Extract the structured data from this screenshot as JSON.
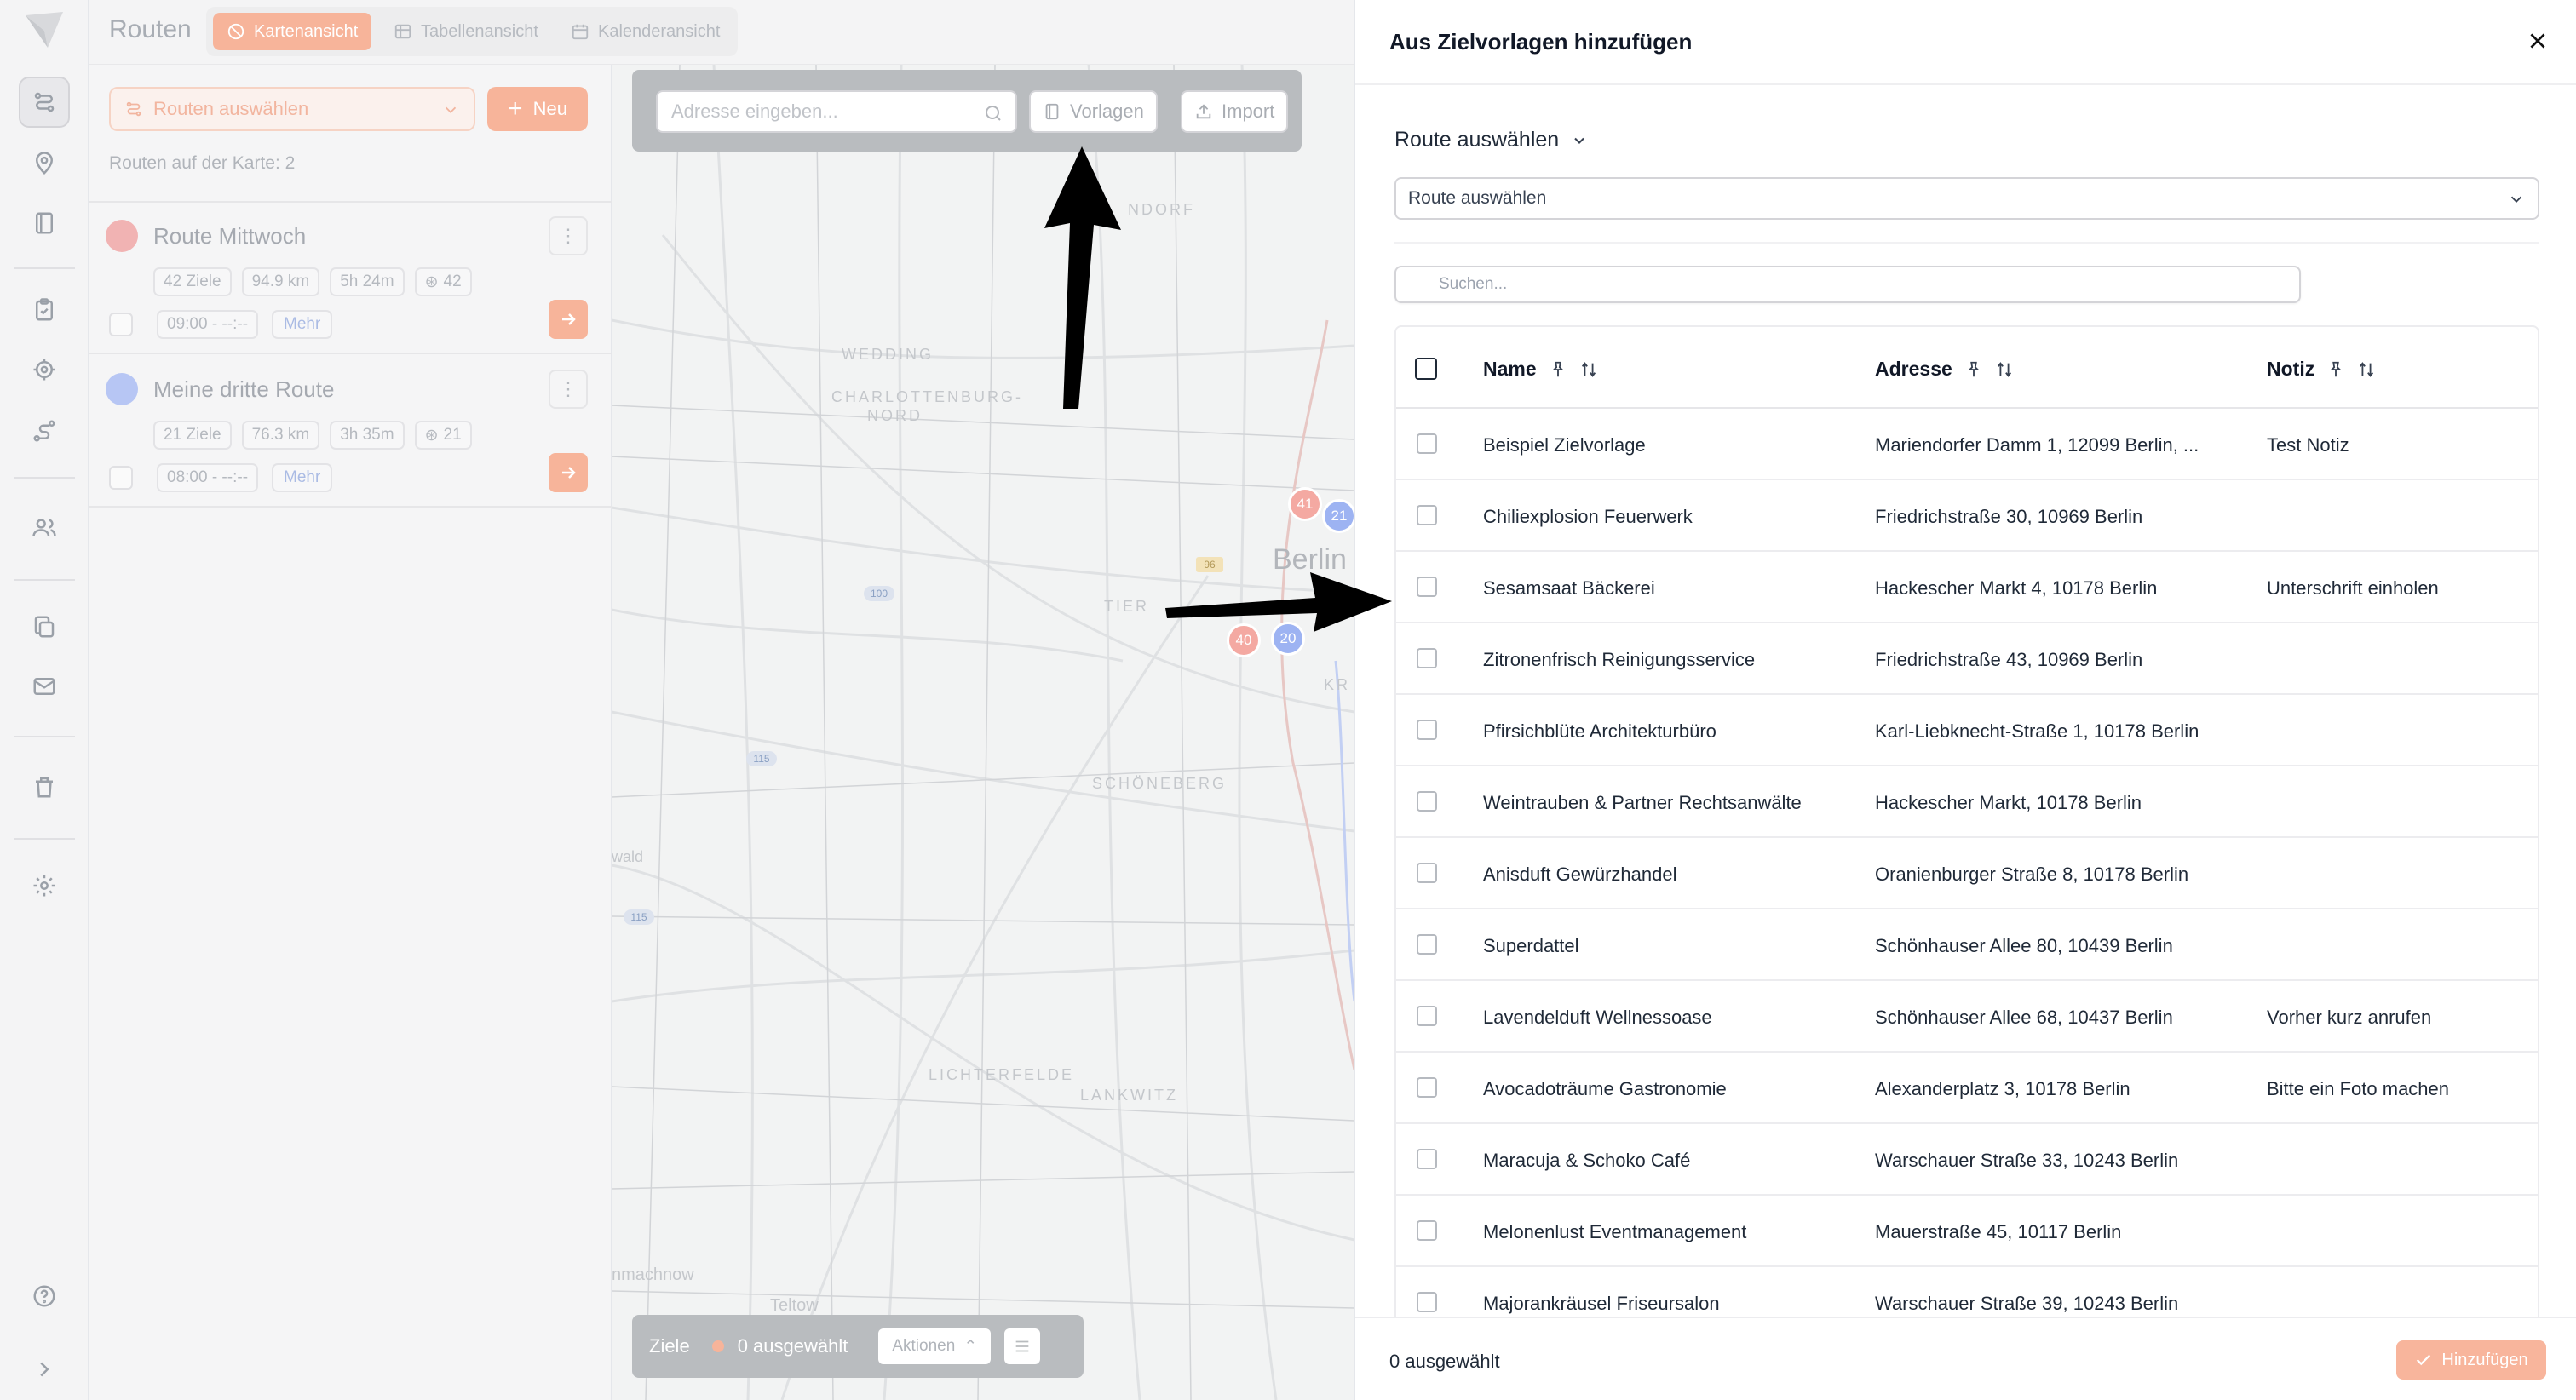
{
  "app": {
    "title": "Routen"
  },
  "view_tabs": [
    {
      "label": "Kartenansicht",
      "active": true,
      "icon": "map-icon"
    },
    {
      "label": "Tabellenansicht",
      "active": false,
      "icon": "table-icon"
    },
    {
      "label": "Kalenderansicht",
      "active": false,
      "icon": "calendar-icon"
    }
  ],
  "routes_panel": {
    "select_label": "Routen auswählen",
    "new_label": "Neu",
    "count_text": "Routen auf der Karte: 2",
    "routes": [
      {
        "name": "Route Mittwoch",
        "color": "#f1b3b3",
        "stops": "42 Ziele",
        "distance": "94.9 km",
        "duration": "5h 24m",
        "packages": "42",
        "time": "09:00 - --:--",
        "more": "Mehr"
      },
      {
        "name": "Meine dritte Route",
        "color": "#b7c6f4",
        "stops": "21 Ziele",
        "distance": "76.3 km",
        "duration": "3h 35m",
        "packages": "21",
        "time": "08:00 - --:--",
        "more": "Mehr"
      }
    ]
  },
  "map": {
    "address_placeholder": "Adresse eingeben...",
    "templates_label": "Vorlagen",
    "import_label": "Import",
    "labels": {
      "dorf": "NDORF",
      "wedding": "WEDDING",
      "charlottenburg": "CHARLOTTENBURG-",
      "nord": "NORD",
      "tier": "TIER",
      "berlin": "Berlin",
      "kr": "KR",
      "schoeneberg": "SCHÖNEBERG",
      "lichterfelde": "LICHTERFELDE",
      "lankwitz": "LANKWITZ",
      "wald": "wald",
      "machnow": "nmachnow",
      "teltow": "Teltow"
    },
    "road_badges": {
      "b96": "96",
      "b100": "100",
      "b115a": "115",
      "b115b": "115"
    },
    "markers": [
      {
        "label": "41",
        "color": "#f4a9a2"
      },
      {
        "label": "21",
        "color": "#9db3f2"
      },
      {
        "label": "40",
        "color": "#f4a9a2"
      },
      {
        "label": "20",
        "color": "#9db3f2"
      }
    ],
    "bottom_bar": {
      "label": "Ziele",
      "selected": "0 ausgewählt",
      "actions": "Aktionen"
    }
  },
  "dialog": {
    "title": "Aus Zielvorlagen hinzufügen",
    "route_section_label": "Route auswählen",
    "route_select_value": "Route auswählen",
    "search_placeholder": "Suchen...",
    "columns": {
      "name": "Name",
      "address": "Adresse",
      "note": "Notiz"
    },
    "rows": [
      {
        "name": "Beispiel Zielvorlage",
        "address": "Mariendorfer Damm 1, 12099 Berlin, ...",
        "note": "Test Notiz"
      },
      {
        "name": "Chiliexplosion Feuerwerk",
        "address": "Friedrichstraße 30, 10969 Berlin",
        "note": ""
      },
      {
        "name": "Sesamsaat Bäckerei",
        "address": "Hackescher Markt 4, 10178 Berlin",
        "note": "Unterschrift einholen"
      },
      {
        "name": "Zitronenfrisch Reinigungsservice",
        "address": "Friedrichstraße 43, 10969 Berlin",
        "note": ""
      },
      {
        "name": "Pfirsichblüte Architekturbüro",
        "address": "Karl-Liebknecht-Straße 1, 10178 Berlin",
        "note": ""
      },
      {
        "name": "Weintrauben & Partner Rechtsanwälte",
        "address": "Hackescher Markt, 10178 Berlin",
        "note": ""
      },
      {
        "name": "Anisduft Gewürzhandel",
        "address": "Oranienburger Straße 8, 10178 Berlin",
        "note": ""
      },
      {
        "name": "Superdattel",
        "address": "Schönhauser Allee 80, 10439 Berlin",
        "note": ""
      },
      {
        "name": "Lavendelduft Wellnessoase",
        "address": "Schönhauser Allee 68, 10437 Berlin",
        "note": "Vorher kurz anrufen"
      },
      {
        "name": "Avocadoträume Gastronomie",
        "address": "Alexanderplatz 3, 10178 Berlin",
        "note": "Bitte ein Foto machen"
      },
      {
        "name": "Maracuja & Schoko Café",
        "address": "Warschauer Straße 33, 10243 Berlin",
        "note": ""
      },
      {
        "name": "Melonenlust Eventmanagement",
        "address": "Mauerstraße 45, 10117 Berlin",
        "note": ""
      },
      {
        "name": "Majorankräusel Friseursalon",
        "address": "Warschauer Straße 39, 10243 Berlin",
        "note": ""
      }
    ],
    "footer": {
      "selected_count": "0 ausgewählt",
      "add_label": "Hinzufügen"
    }
  },
  "colors": {
    "accent": "#f7b49a",
    "route_red": "#f1b3b3",
    "route_blue": "#b7c6f4"
  }
}
